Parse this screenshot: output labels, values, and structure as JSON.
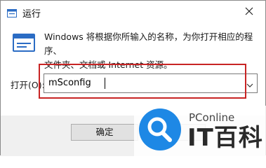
{
  "window": {
    "title": "运行",
    "title_icon": "run-app-icon",
    "close_icon": "close-icon"
  },
  "description": {
    "line1": "Windows 将根据你所输入的名称，为你打开相应的程序、",
    "line2": "文件夹、文档或 Internet 资源。"
  },
  "open_field": {
    "label": "打开(O):",
    "value": "mSconfig",
    "dropdown_icon": "chevron-down-icon"
  },
  "buttons": {
    "ok_label": "确定"
  },
  "watermark": {
    "site": "PConline",
    "brand": "IT百科"
  },
  "colors": {
    "highlight_border": "#c82424",
    "footer_bg": "#f0f0f0",
    "logo_blue": "#1e88e5"
  }
}
